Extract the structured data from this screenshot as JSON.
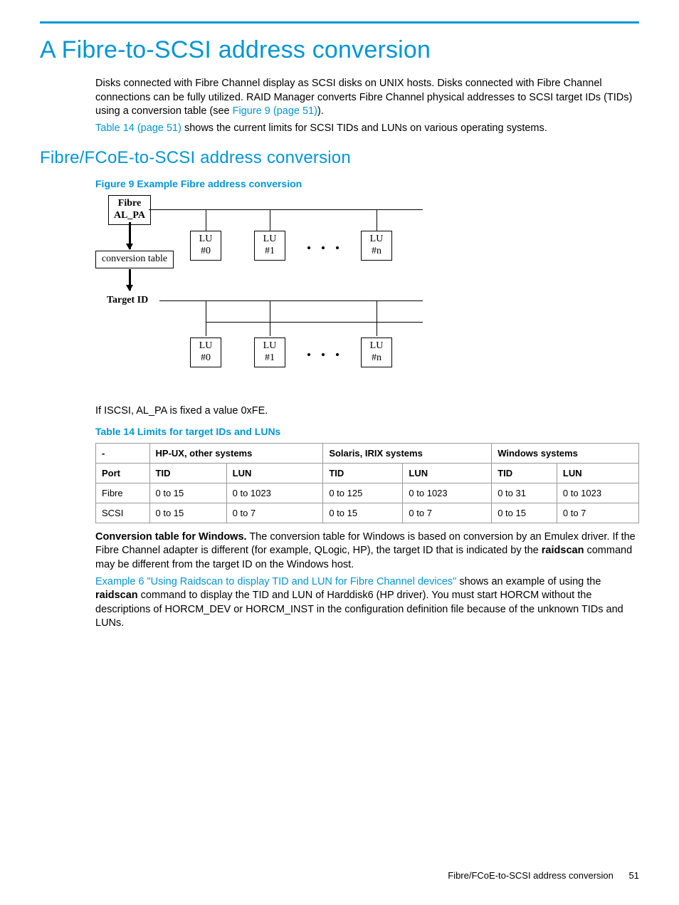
{
  "h1": "A Fibre-to-SCSI address conversion",
  "intro1": "Disks connected with Fibre Channel display as SCSI disks on UNIX hosts. Disks connected with Fibre Channel connections can be fully utilized. RAID Manager converts Fibre Channel physical addresses to SCSI target IDs (TIDs) using a conversion table (see ",
  "intro1_link": "Figure 9 (page 51)",
  "intro1_tail": ").",
  "intro2_link": "Table 14 (page 51)",
  "intro2_tail": " shows the current limits for SCSI TIDs and LUNs on various operating systems.",
  "h2": "Fibre/FCoE-to-SCSI address conversion",
  "fig_caption": "Figure 9 Example Fibre address conversion",
  "diagram": {
    "fibre": "Fibre",
    "alpa": "AL_PA",
    "conv": "conversion table",
    "target": "Target ID",
    "lu": "LU",
    "n0": "#0",
    "n1": "#1",
    "nn": "#n"
  },
  "iscsi_note": "If ISCSI, AL_PA is fixed a value 0xFE.",
  "table_caption": "Table 14 Limits for target IDs and LUNs",
  "table": {
    "head_dash": "-",
    "head_hpux": "HP-UX, other systems",
    "head_solaris": "Solaris, IRIX systems",
    "head_windows": "Windows systems",
    "port": "Port",
    "tid": "TID",
    "lun": "LUN",
    "rows": [
      {
        "port": "Fibre",
        "hp_tid": "0 to 15",
        "hp_lun": "0 to 1023",
        "sol_tid": "0 to 125",
        "sol_lun": "0 to 1023",
        "win_tid": "0 to 31",
        "win_lun": "0 to 1023"
      },
      {
        "port": "SCSI",
        "hp_tid": "0 to 15",
        "hp_lun": "0 to 7",
        "sol_tid": "0 to 15",
        "sol_lun": "0 to 7",
        "win_tid": "0 to 15",
        "win_lun": "0 to 7"
      }
    ]
  },
  "para_conv_bold": "Conversion table for Windows.",
  "para_conv_a": " The conversion table for Windows is based on conversion by an Emulex driver. If the Fibre Channel adapter is different (for example, QLogic, HP), the target ID that is indicated by the ",
  "para_conv_bold2": "raidscan",
  "para_conv_b": " command may be different from the target ID on the Windows host.",
  "example_link": "Example 6 \"Using Raidscan to display TID and LUN for Fibre Channel devices\"",
  "para_ex_a": " shows an example of using the ",
  "para_ex_bold": "raidscan",
  "para_ex_b": " command to display the TID and LUN of Harddisk6 (HP driver). You must start HORCM without the descriptions of HORCM_DEV or HORCM_INST in the configuration definition file because of the unknown TIDs and LUNs.",
  "footer_section": "Fibre/FCoE-to-SCSI address conversion",
  "footer_page": "51",
  "chart_data": {
    "type": "table",
    "title": "Table 14 Limits for target IDs and LUNs",
    "columns": [
      "Port",
      "HP-UX TID",
      "HP-UX LUN",
      "Solaris/IRIX TID",
      "Solaris/IRIX LUN",
      "Windows TID",
      "Windows LUN"
    ],
    "rows": [
      [
        "Fibre",
        "0 to 15",
        "0 to 1023",
        "0 to 125",
        "0 to 1023",
        "0 to 31",
        "0 to 1023"
      ],
      [
        "SCSI",
        "0 to 15",
        "0 to 7",
        "0 to 15",
        "0 to 7",
        "0 to 15",
        "0 to 7"
      ]
    ]
  }
}
